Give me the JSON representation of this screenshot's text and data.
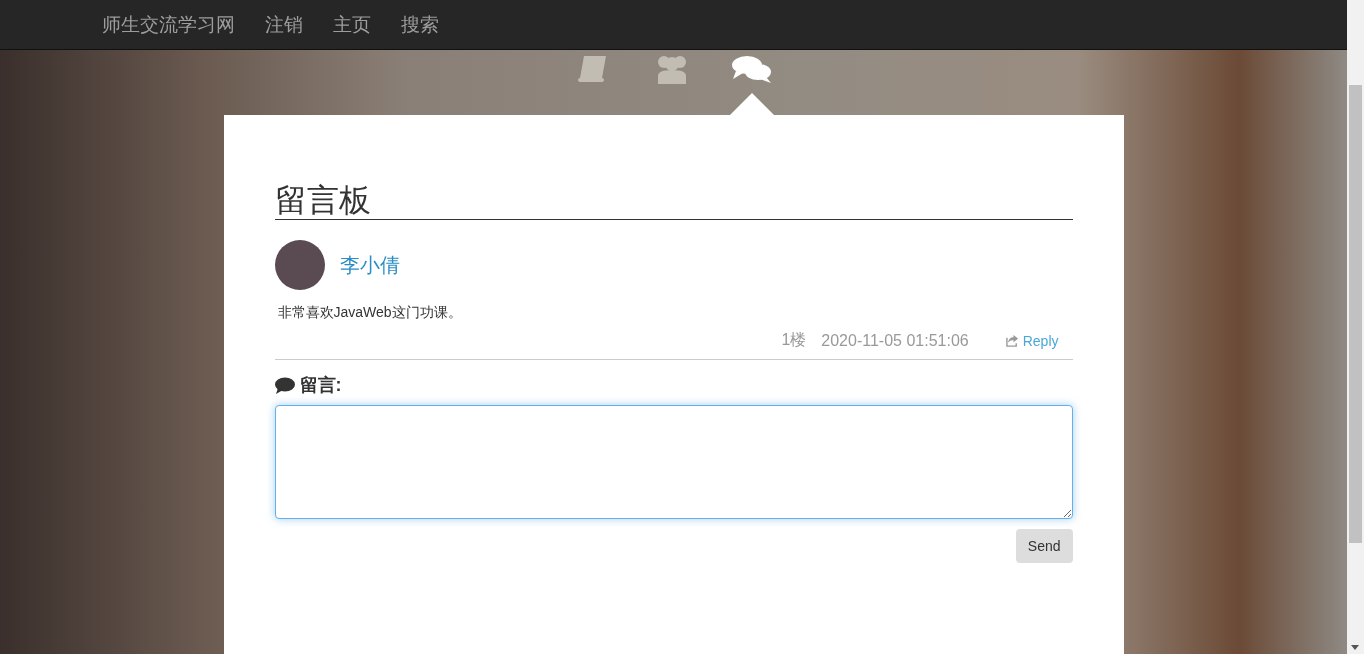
{
  "navbar": {
    "brand": "师生交流学习网",
    "links": [
      "注销",
      "主页",
      "搜索"
    ]
  },
  "tabs": [
    {
      "kind": "book",
      "selected": false
    },
    {
      "kind": "users",
      "selected": false
    },
    {
      "kind": "comments",
      "selected": true
    }
  ],
  "board": {
    "title": "留言板",
    "messages": [
      {
        "author": "李小倩",
        "text": "非常喜欢JavaWeb这门功课。",
        "floor": "1楼",
        "time": "2020-11-05 01:51:06",
        "reply": "Reply"
      }
    ],
    "compose": {
      "label": "留言:",
      "button": "Send"
    }
  }
}
